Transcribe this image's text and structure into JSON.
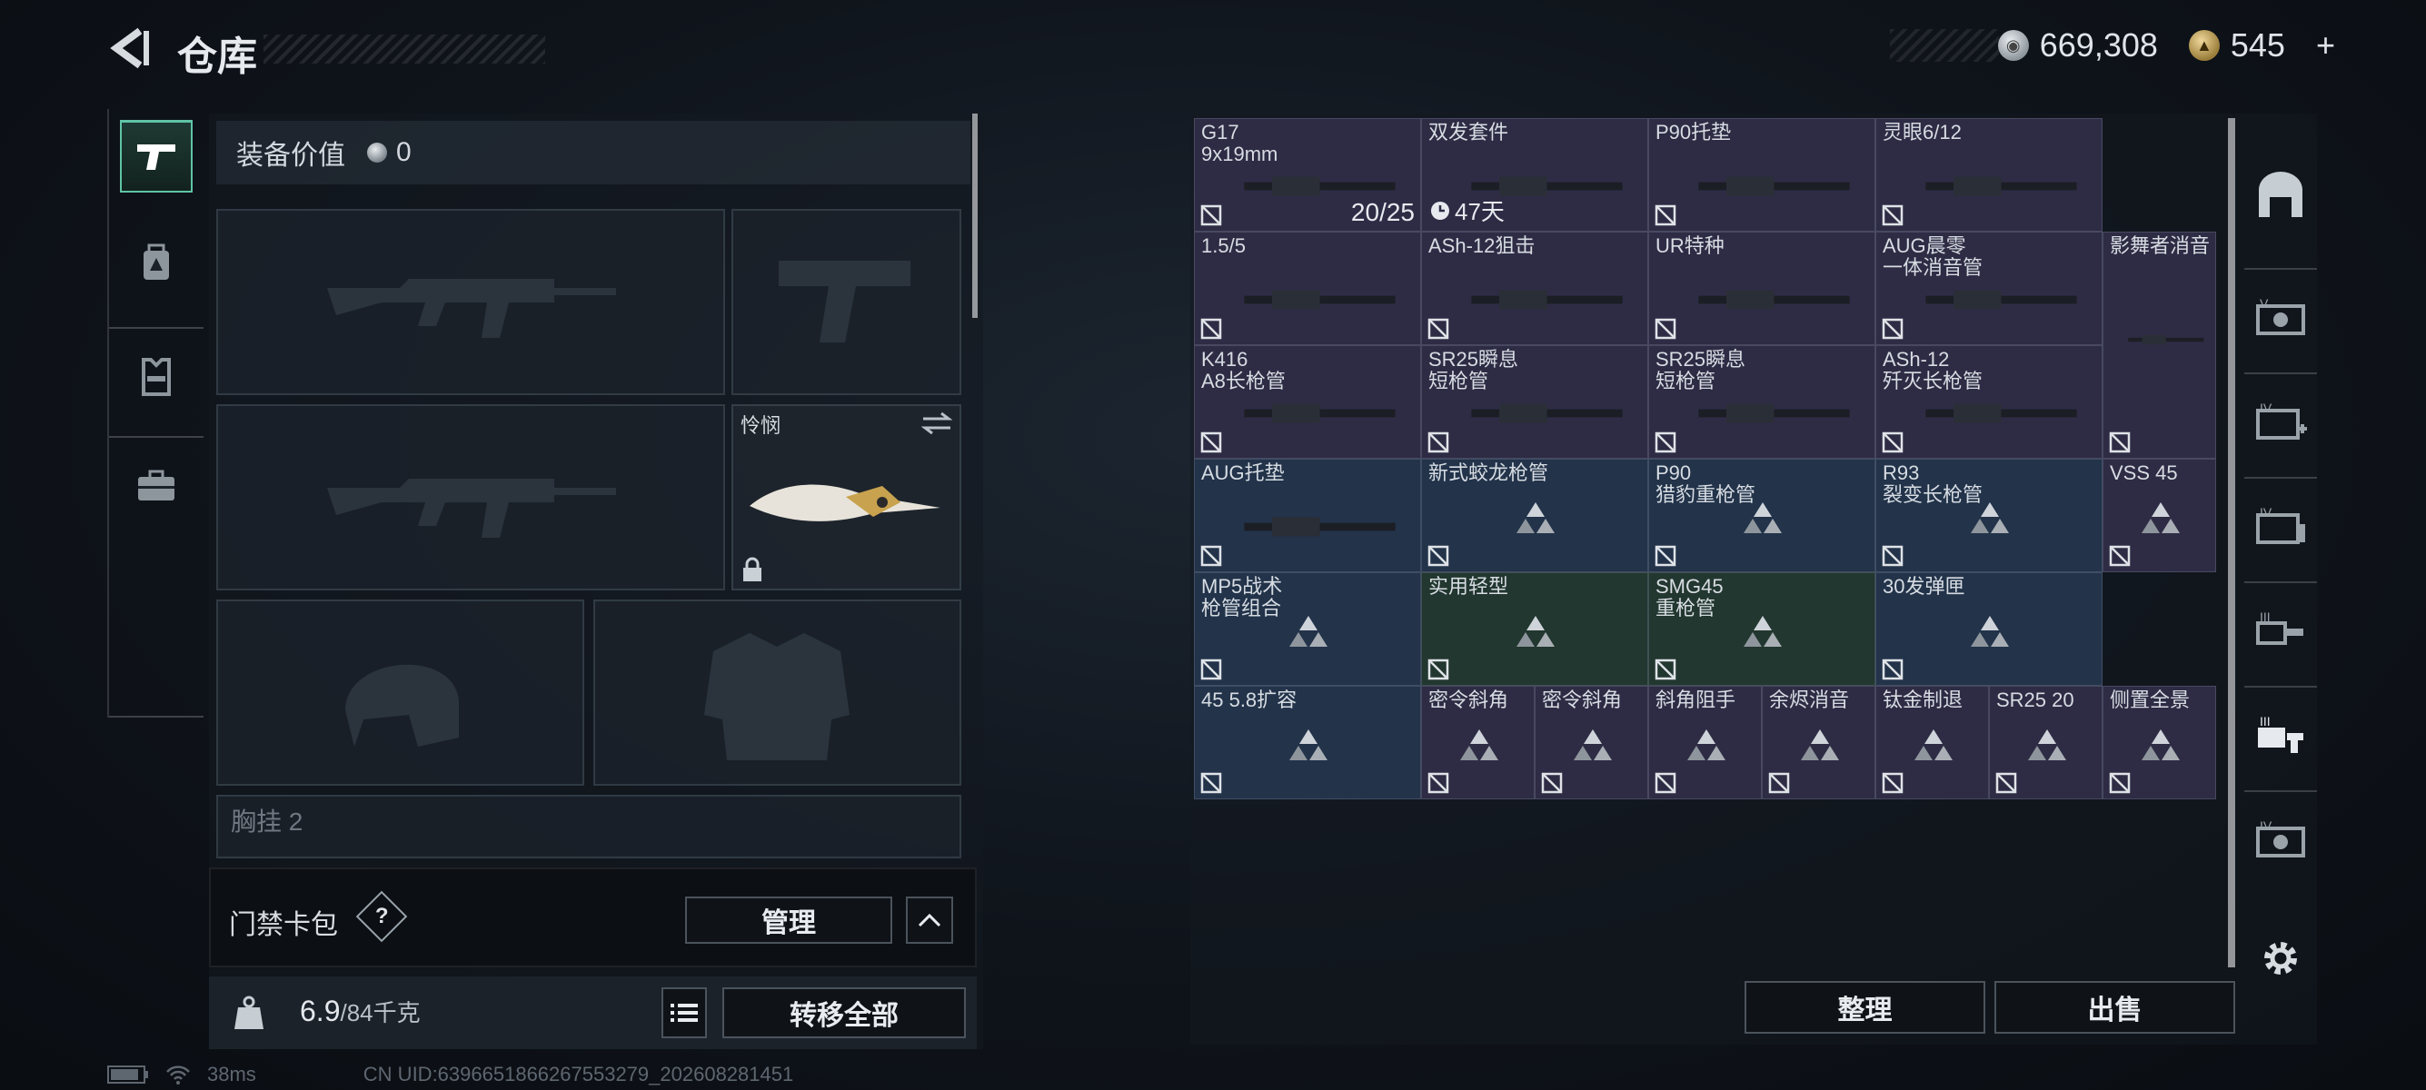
{
  "header": {
    "title": "仓库",
    "currency": [
      {
        "icon": "silver-coin-icon",
        "value": "669,308"
      },
      {
        "icon": "gold-coin-icon",
        "value": "545"
      }
    ],
    "add_label": "+"
  },
  "rail": {
    "items": [
      "pistol-icon",
      "backpack-icon",
      "vest-icon",
      "case-icon"
    ]
  },
  "equipment": {
    "value_label": "装备价值",
    "value": "0",
    "melee_name": "怜悯",
    "chest_label": "胸挂 2",
    "gate_label": "门禁卡包",
    "help_label": "?",
    "manage_label": "管理",
    "weight_current": "6.9",
    "weight_cap": "/84千克",
    "transfer_all_label": "转移全部"
  },
  "storage": {
    "items": [
      {
        "name": "G17\n9x19mm",
        "count": "20/25",
        "color": "purple"
      },
      {
        "name": "双发套件",
        "timer": "47天",
        "color": "purple"
      },
      {
        "name": "P90托垫",
        "color": "purple"
      },
      {
        "name": "灵眼6/12",
        "color": "purple"
      },
      {
        "name": "1.5/5",
        "color": "purple"
      },
      {
        "name": "ASh-12狙击",
        "color": "purple"
      },
      {
        "name": "UR特种",
        "color": "purple"
      },
      {
        "name": "AUG晨零\n一体消音管",
        "color": "purple"
      },
      {
        "name": "影舞者消音",
        "color": "purple"
      },
      {
        "name": "K416\nA8长枪管",
        "color": "purple"
      },
      {
        "name": "SR25瞬息\n短枪管",
        "color": "purple"
      },
      {
        "name": "SR25瞬息\n短枪管",
        "color": "purple"
      },
      {
        "name": "ASh-12\n歼灭长枪管",
        "color": "purple"
      },
      {
        "name": "AUG托垫",
        "color": "blue"
      },
      {
        "name": "新式蛟龙枪管",
        "color": "blue"
      },
      {
        "name": "P90\n猎豹重枪管",
        "color": "blue"
      },
      {
        "name": "R93\n裂变长枪管",
        "color": "blue"
      },
      {
        "name": "VSS 45",
        "color": "purple"
      },
      {
        "name": "MP5战术\n枪管组合",
        "color": "blue"
      },
      {
        "name": "实用轻型",
        "color": "green"
      },
      {
        "name": "SMG45\n重枪管",
        "color": "green"
      },
      {
        "name": "30发弹匣",
        "color": "blue"
      },
      {
        "name": "45 5.8扩容",
        "color": "blue"
      },
      {
        "name": "密令斜角",
        "color": "purple"
      },
      {
        "name": "密令斜角",
        "color": "purple"
      },
      {
        "name": "斜角阻手",
        "color": "purple"
      },
      {
        "name": "余烬消音",
        "color": "purple"
      },
      {
        "name": "钛金制退",
        "color": "purple"
      },
      {
        "name": "SR25 20",
        "color": "purple"
      },
      {
        "name": "侧置全景",
        "color": "purple"
      }
    ],
    "sort_label": "整理",
    "sell_label": "出售"
  },
  "status": {
    "ping": "38ms",
    "uid": "CN UID:6396651866267553279_202608281451"
  }
}
